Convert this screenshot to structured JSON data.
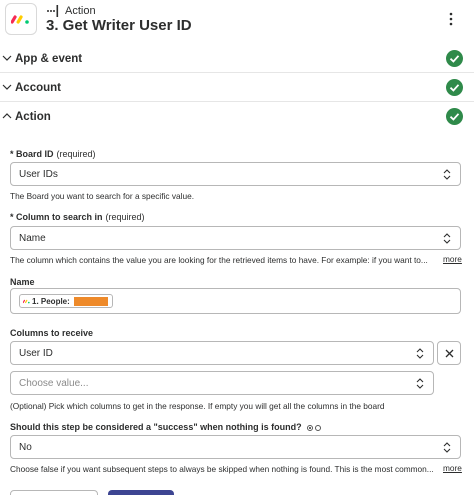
{
  "header": {
    "step_type": "Action",
    "title": "3. Get Writer User ID"
  },
  "sections": {
    "app_event": "App & event",
    "account": "Account",
    "action": "Action"
  },
  "fields": {
    "board_id": {
      "label": "Board ID",
      "required": "(required)",
      "value": "User IDs",
      "help": "The Board you want to search for a specific value."
    },
    "column_search": {
      "label": "Column to search in",
      "required": "(required)",
      "value": "Name",
      "help": "The column which contains the value you are looking for the retrieved items to have. For example: if you want to...",
      "more": "more"
    },
    "name": {
      "label": "Name",
      "pill": "1. People:"
    },
    "columns_receive": {
      "label": "Columns to receive",
      "value": "User ID",
      "placeholder": "Choose value...",
      "help": "(Optional) Pick which columns to get in the response. If empty you will get all the columns in the board"
    },
    "success_nothing": {
      "label": "Should this step be considered a \"success\" when nothing is found?",
      "value": "No",
      "help": "Choose false if you want subsequent steps to always be skipped when nothing is found. This is the most common...",
      "more": "more"
    }
  },
  "colors": {
    "success_green": "#2f8a4a",
    "primary_button": "#3d4592",
    "redaction": "#ee8a2a"
  }
}
